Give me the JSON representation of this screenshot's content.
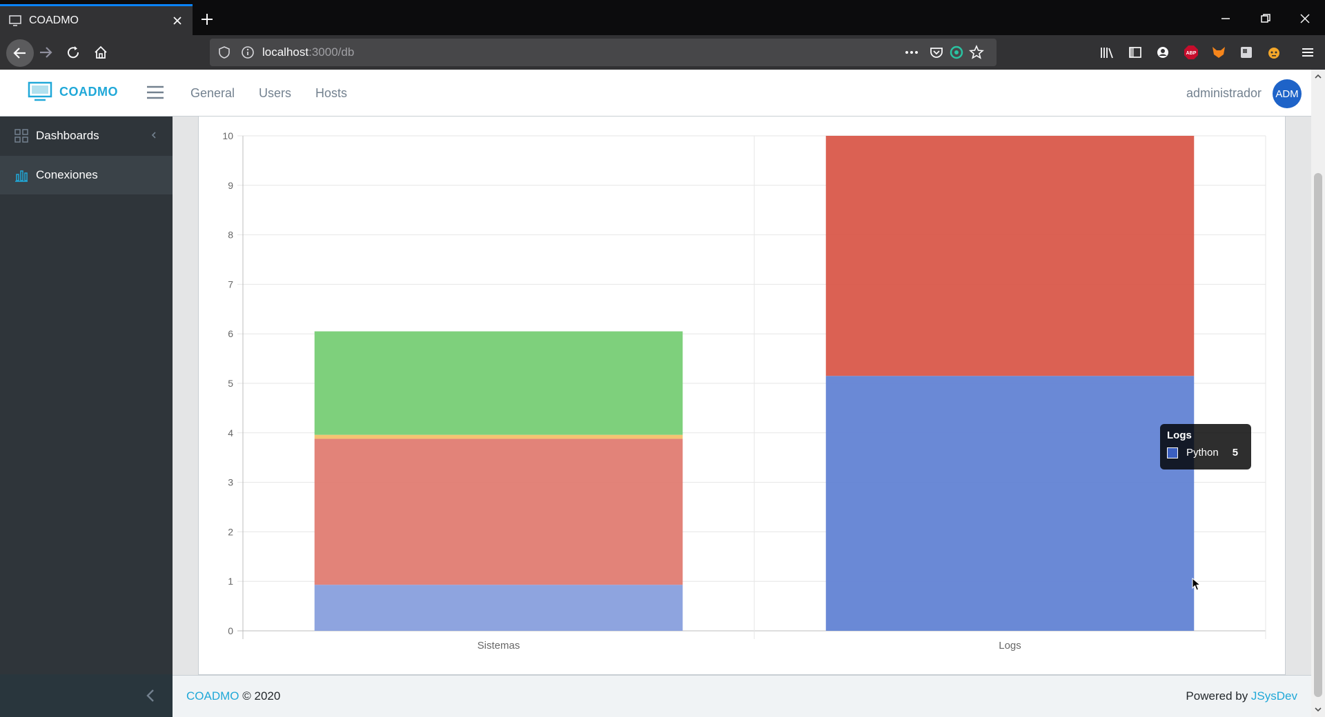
{
  "browser": {
    "tab_title": "COADMO",
    "url_host": "localhost",
    "url_path": ":3000/db"
  },
  "header": {
    "brand": "COADMO",
    "nav": [
      "General",
      "Users",
      "Hosts"
    ],
    "username": "administrador",
    "avatar_initials": "ADM"
  },
  "sidebar": {
    "items": [
      {
        "label": "Dashboards",
        "icon": "grid-icon"
      },
      {
        "label": "Conexiones",
        "icon": "bar-chart-icon"
      }
    ]
  },
  "chart_data": {
    "type": "bar",
    "stacked": true,
    "categories": [
      "Sistemas",
      "Logs"
    ],
    "ylim": [
      0,
      10
    ],
    "yticks": [
      0,
      1,
      2,
      3,
      4,
      5,
      6,
      7,
      8,
      9,
      10
    ],
    "grid": true,
    "series": [
      {
        "values": [
          0.93,
          5.15
        ],
        "color": "#6283d4"
      },
      {
        "values": [
          2.95,
          4.85
        ],
        "color": "#d9584a"
      },
      {
        "values": [
          0.08,
          0
        ],
        "color": "#f5b94c"
      },
      {
        "values": [
          2.09,
          0
        ],
        "color": "#6cc46a"
      }
    ],
    "series_colors_sistemas": [
      "#889fdd",
      "#e07c72",
      "#f3c06a",
      "#77cd75"
    ],
    "tooltip": {
      "title": "Logs",
      "label": "Python",
      "value": "5"
    }
  },
  "footer": {
    "brand_link": "COADMO",
    "copyright": "© 2020",
    "powered_prefix": "Powered by ",
    "powered_link": "JSysDev"
  }
}
